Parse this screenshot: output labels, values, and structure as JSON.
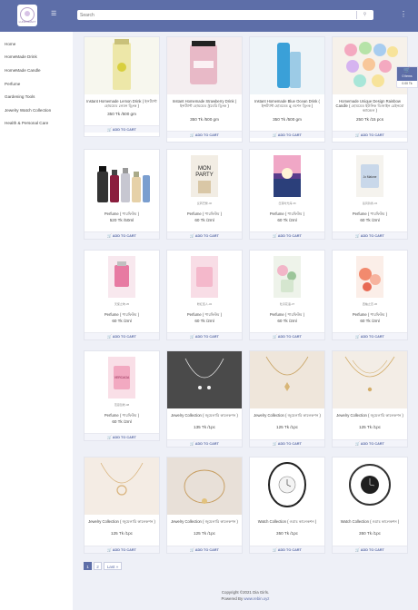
{
  "header": {
    "logo_text": "LUNA CRAFT",
    "search_placeholder": "Search",
    "search_icon": "search-icon",
    "menu_icon": "hamburger-icon",
    "more_icon": "kebab-icon"
  },
  "sidebar": {
    "items": [
      {
        "label": "Home"
      },
      {
        "label": "HomeMade Drink"
      },
      {
        "label": "HomeMade Candle"
      },
      {
        "label": "Perfume"
      },
      {
        "label": "Gardening Tools"
      },
      {
        "label": "Jewelry Watch Collection"
      },
      {
        "label": "Health & Personal Care"
      }
    ]
  },
  "products": [
    {
      "title": "Instant Homemade Lemon Drink ( ইন্সট্যান্ট হোমমেড লেমন ড্রিংক )",
      "price": "350 Tk /500 gm",
      "cart": "ADD TO CART",
      "caption": ""
    },
    {
      "title": "Instant Homemade Strawberry Drink ( ইন্সট্যান্ট হোমমেড স্ট্রবেরি ড্রিংক )",
      "price": "350 Tk /500 gm",
      "cart": "ADD TO CART",
      "caption": ""
    },
    {
      "title": "Instant Homemade Blue Ocean Drink ( ইন্সট্যান্ট হোমমেড ব্লু ওশেন ড্রিংক )",
      "price": "350 Tk /500 gm",
      "cart": "ADD TO CART",
      "caption": ""
    },
    {
      "title": "Homemade Unique Design Rainbow Candle ( হোমমেড ইউনিক ডিজাইন রেইনবো ক্যান্ডেল )",
      "price": "250 Tk /15 pcs",
      "cart": "ADD TO CART",
      "caption": ""
    },
    {
      "title": "Perfume ( পারফিউম )",
      "price": "520 Tk /50ml",
      "cart": "ADD TO CART",
      "caption": ""
    },
    {
      "title": "Perfume ( পারফিউম )",
      "price": "60 Tk /2ml",
      "cart": "ADD TO CART",
      "caption": "反转巴黎-40"
    },
    {
      "title": "Perfume ( পারফিউম )",
      "price": "60 Tk /2ml",
      "cart": "ADD TO CART",
      "caption": "日落时光海-36"
    },
    {
      "title": "Perfume ( পারফিউম )",
      "price": "60 Tk /2ml",
      "cart": "ADD TO CART",
      "caption": "蓝风铃香-34"
    },
    {
      "title": "Perfume ( পারফিউম )",
      "price": "60 Tk /2ml",
      "cart": "ADD TO CART",
      "caption": "天使之吻-35"
    },
    {
      "title": "Perfume ( পারফিউম )",
      "price": "60 Tk /2ml",
      "cart": "ADD TO CART",
      "caption": "粉红佳人-32"
    },
    {
      "title": "Perfume ( পারফিউম )",
      "price": "60 Tk /2ml",
      "cart": "ADD TO CART",
      "caption": "牡丹花语-37"
    },
    {
      "title": "Perfume ( পারফিউম )",
      "price": "60 Tk /2ml",
      "cart": "ADD TO CART",
      "caption": "西柚之恋-36"
    },
    {
      "title": "Perfume ( পারফিউম )",
      "price": "60 Tk /2ml",
      "cart": "ADD TO CART",
      "caption": "范思哲粉-08"
    },
    {
      "title": "Jewelry Collection ( জুয়েলারি কালেকশন )",
      "price": "135 Tk /1pc",
      "cart": "ADD TO CART",
      "caption": ""
    },
    {
      "title": "Jewelry Collection ( জুয়েলারি কালেকশন )",
      "price": "125 Tk /1pc",
      "cart": "ADD TO CART",
      "caption": ""
    },
    {
      "title": "Jewelry Collection ( জুয়েলারি কালেকশন )",
      "price": "125 Tk /1pc",
      "cart": "ADD TO CART",
      "caption": ""
    },
    {
      "title": "Jewelry Collection ( জুয়েলারি কালেকশন )",
      "price": "125 Tk /1pc",
      "cart": "ADD TO CART",
      "caption": ""
    },
    {
      "title": "Jewelry Collection ( জুয়েলারি কালেকশন )",
      "price": "125 Tk /1pc",
      "cart": "ADD TO CART",
      "caption": ""
    },
    {
      "title": "Watch Collection ( ওয়াচ কালেকশন )",
      "price": "350 Tk /1pc",
      "cart": "ADD TO CART",
      "caption": ""
    },
    {
      "title": "Watch Collection ( ওয়াচ কালেকশন )",
      "price": "350 Tk /1pc",
      "cart": "ADD TO CART",
      "caption": ""
    }
  ],
  "pagination": {
    "pages": [
      "1",
      "2"
    ],
    "last": "Last »",
    "current": "1"
  },
  "footer": {
    "copyright": "Copyright ©2021 Dia Girls.",
    "powered_label": "Powered By",
    "powered_link": "www.rebin.xyz"
  },
  "cart_widget": {
    "items": "0 Items",
    "total": "0.00 Tk"
  },
  "colors": {
    "accent": "#5d6ea8",
    "background": "#eef0f7",
    "card": "#ffffff"
  }
}
